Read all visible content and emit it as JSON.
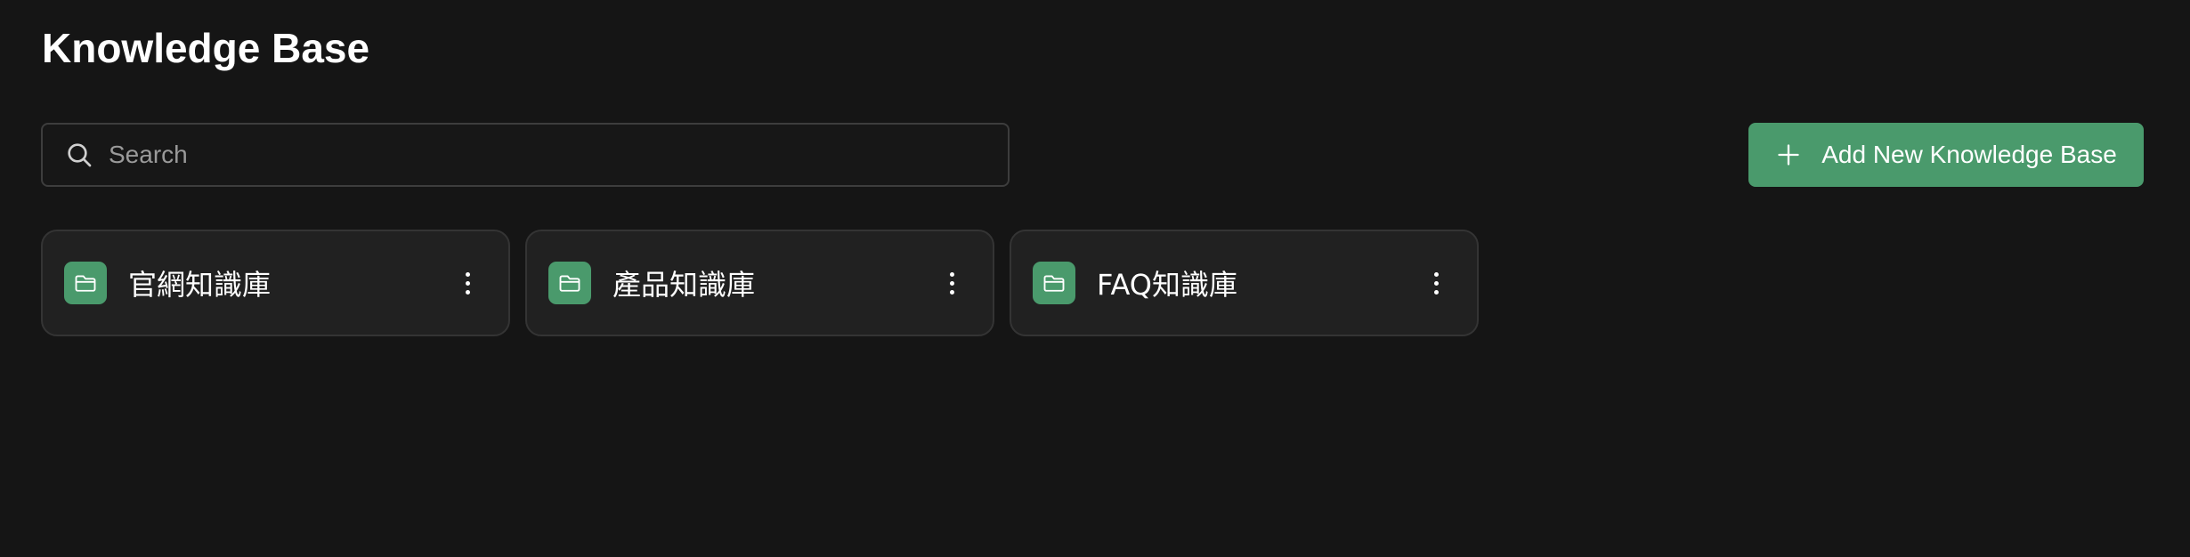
{
  "page": {
    "title": "Knowledge Base"
  },
  "search": {
    "placeholder": "Search",
    "value": "",
    "icon": "search-icon"
  },
  "actions": {
    "add_label": "Add New Knowledge Base",
    "add_icon": "plus-icon"
  },
  "knowledge_bases": [
    {
      "label": "官網知識庫",
      "icon": "folder-icon",
      "menu_icon": "more-vertical-icon"
    },
    {
      "label": "產品知識庫",
      "icon": "folder-icon",
      "menu_icon": "more-vertical-icon"
    },
    {
      "label": "FAQ知識庫",
      "icon": "folder-icon",
      "menu_icon": "more-vertical-icon"
    }
  ],
  "colors": {
    "background": "#151515",
    "accent": "#4a9a6c",
    "card_background": "#212121",
    "card_border": "#343434"
  }
}
